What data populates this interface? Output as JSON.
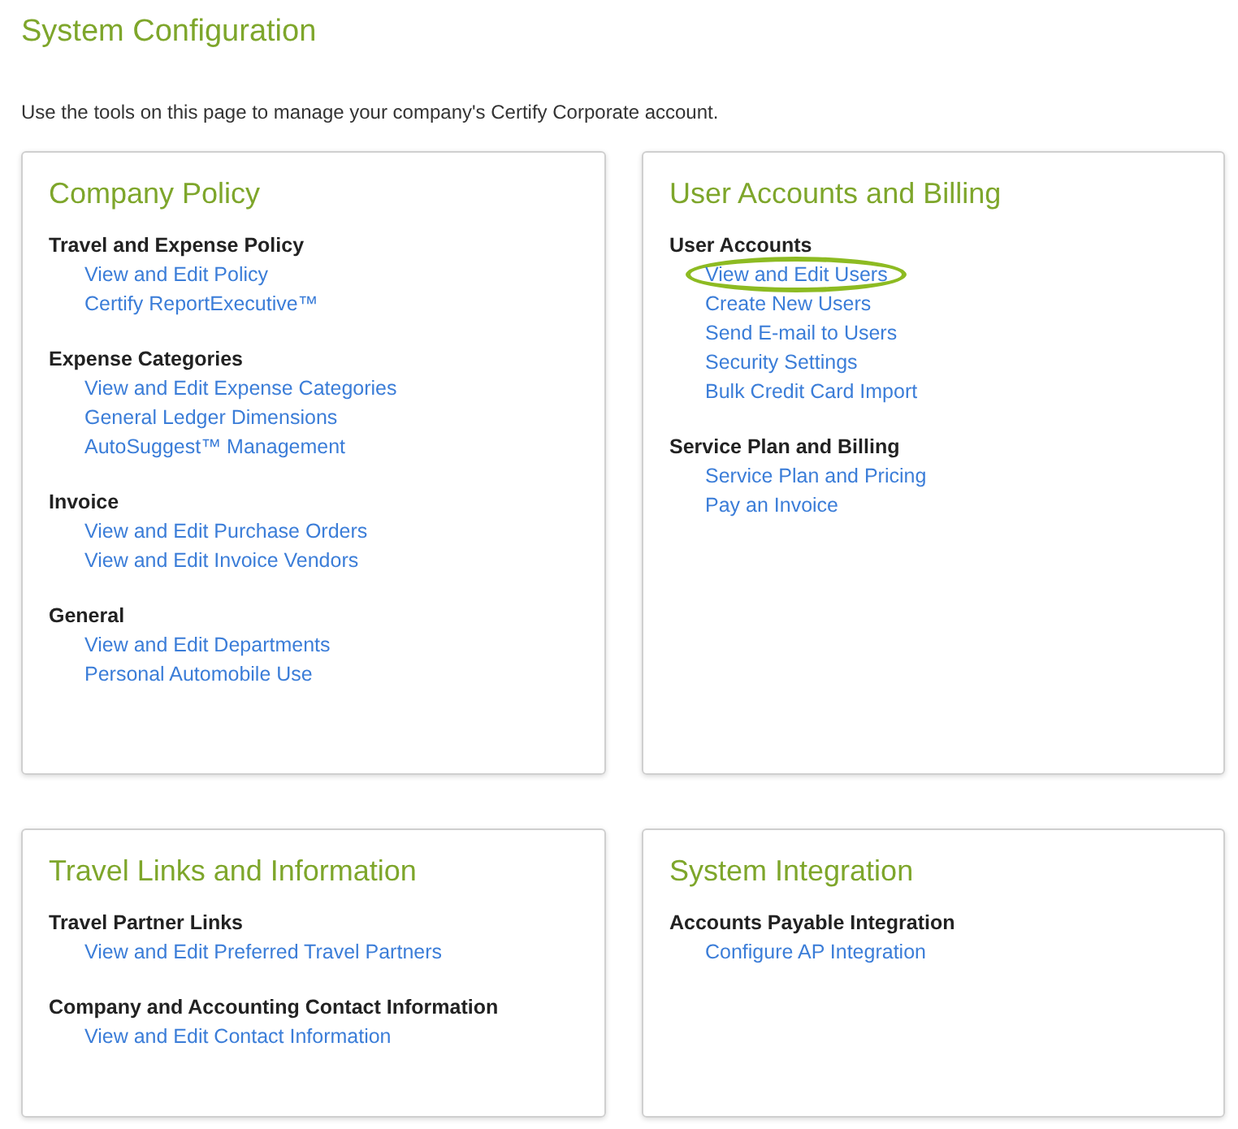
{
  "title": "System Configuration",
  "intro": "Use the tools on this page to manage your company's Certify Corporate account.",
  "cards": [
    {
      "title": "Company Policy",
      "groups": [
        {
          "heading": "Travel and Expense Policy",
          "links": [
            {
              "text": "View and Edit Policy",
              "circled": false
            },
            {
              "text": "Certify ReportExecutive™",
              "circled": false
            }
          ]
        },
        {
          "heading": "Expense Categories",
          "links": [
            {
              "text": "View and Edit Expense Categories",
              "circled": false
            },
            {
              "text": "General Ledger Dimensions",
              "circled": false
            },
            {
              "text": "AutoSuggest™ Management",
              "circled": false
            }
          ]
        },
        {
          "heading": "Invoice",
          "links": [
            {
              "text": "View and Edit Purchase Orders",
              "circled": false
            },
            {
              "text": "View and Edit Invoice Vendors",
              "circled": false
            }
          ]
        },
        {
          "heading": "General",
          "links": [
            {
              "text": "View and Edit Departments",
              "circled": false
            },
            {
              "text": "Personal Automobile Use",
              "circled": false
            }
          ]
        }
      ]
    },
    {
      "title": "User Accounts and Billing",
      "groups": [
        {
          "heading": "User Accounts",
          "links": [
            {
              "text": "View and Edit Users",
              "circled": true
            },
            {
              "text": "Create New Users",
              "circled": false
            },
            {
              "text": "Send E-mail to Users",
              "circled": false
            },
            {
              "text": "Security Settings",
              "circled": false
            },
            {
              "text": "Bulk Credit Card Import",
              "circled": false
            }
          ]
        },
        {
          "heading": "Service Plan and Billing",
          "links": [
            {
              "text": "Service Plan and Pricing",
              "circled": false
            },
            {
              "text": "Pay an Invoice",
              "circled": false
            }
          ]
        }
      ]
    },
    {
      "title": "Travel Links and Information",
      "groups": [
        {
          "heading": "Travel Partner Links",
          "links": [
            {
              "text": "View and Edit Preferred Travel Partners",
              "circled": false
            }
          ]
        },
        {
          "heading": "Company and Accounting Contact Information",
          "links": [
            {
              "text": "View and Edit Contact Information",
              "circled": false
            }
          ]
        }
      ]
    },
    {
      "title": "System Integration",
      "groups": [
        {
          "heading": "Accounts Payable Integration",
          "links": [
            {
              "text": "Configure AP Integration",
              "circled": false
            }
          ]
        }
      ]
    }
  ]
}
